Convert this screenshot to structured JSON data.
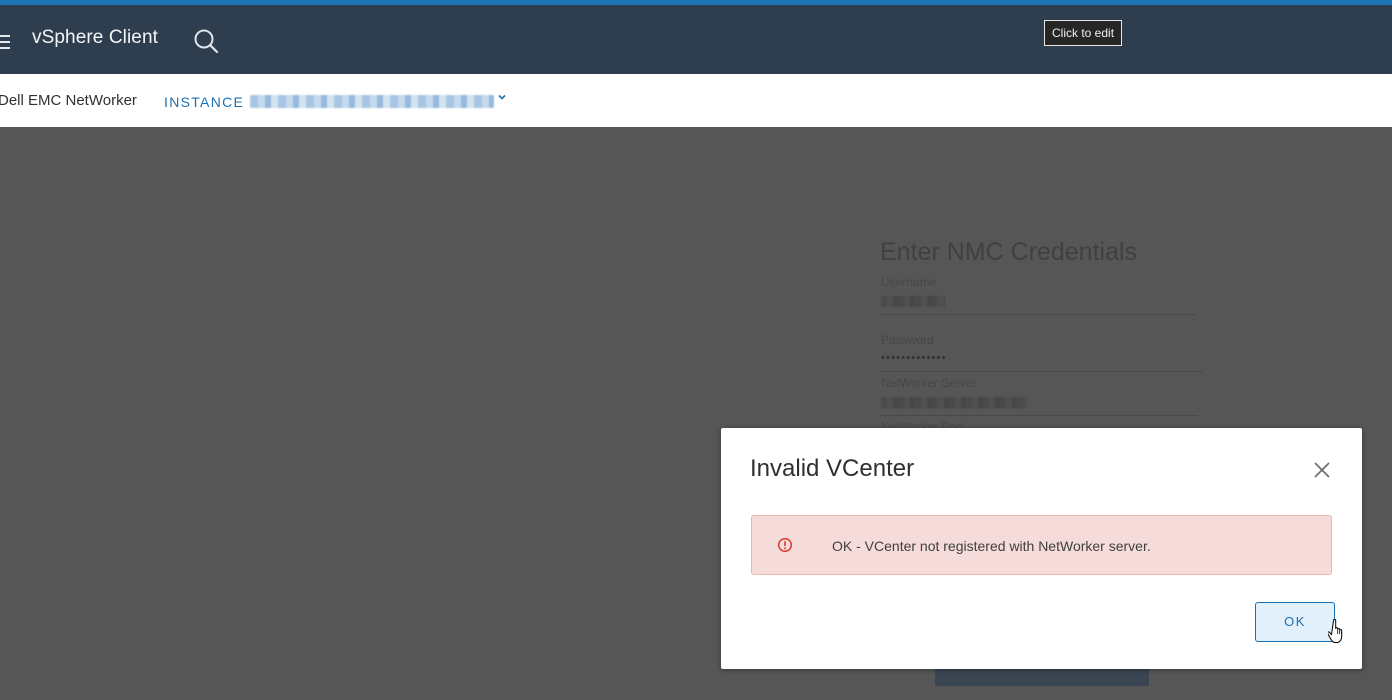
{
  "header": {
    "app_title": "vSphere Client",
    "menu_icon": "hamburger-icon",
    "search_icon": "search-icon",
    "tooltip": "Click to edit"
  },
  "subbar": {
    "plugin_name": "Dell EMC NetWorker",
    "instance_label": "INSTANCE",
    "instance_value": "",
    "caret_icon": "chevron-down-icon"
  },
  "credentials": {
    "title": "Enter NMC Credentials",
    "username_label": "Username",
    "username_value": "",
    "password_label": "Password",
    "password_dots": "•••••••••••••",
    "server_label": "NetWorker Server",
    "server_value": "",
    "port_label": "NetWorker Port"
  },
  "dialog": {
    "title": "Invalid VCenter",
    "message": "OK - VCenter not registered with NetWorker server.",
    "ok_label": "OK",
    "close_icon": "close-icon",
    "alert_icon": "error-icon"
  },
  "colors": {
    "header_bg": "#2f3e4e",
    "accent": "#1d6fb0",
    "alert_bg": "#f5dbd9",
    "alert_border": "#e9b6b0",
    "error": "#d93a2b"
  }
}
